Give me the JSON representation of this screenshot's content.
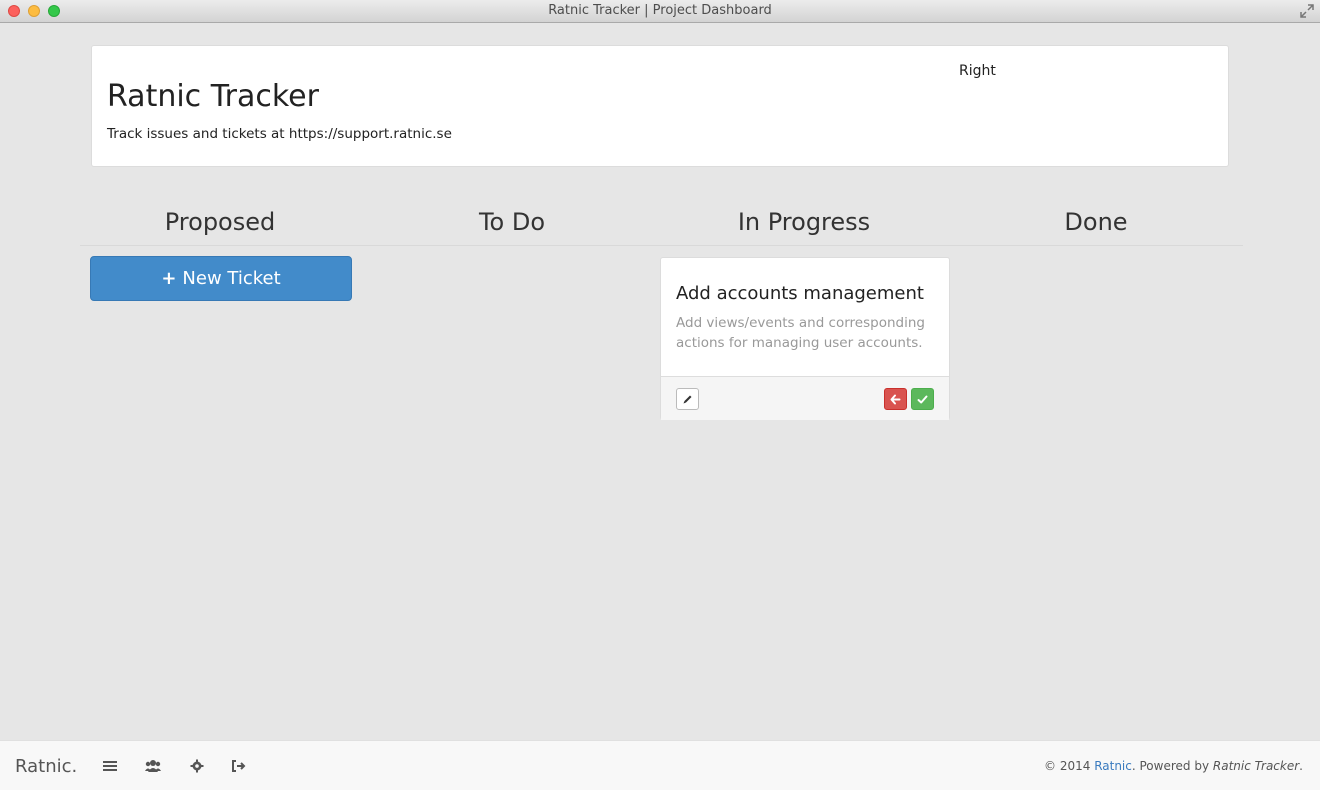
{
  "window": {
    "title": "Ratnic Tracker | Project Dashboard"
  },
  "header": {
    "title": "Ratnic Tracker",
    "subtitle": "Track issues and tickets at https://support.ratnic.se",
    "right_text": "Right"
  },
  "columns": [
    {
      "label": "Proposed"
    },
    {
      "label": "To Do"
    },
    {
      "label": "In Progress"
    },
    {
      "label": "Done"
    }
  ],
  "new_ticket": {
    "plus": "+",
    "label": "New Ticket"
  },
  "tickets": [
    {
      "column": "In Progress",
      "title": "Add accounts management",
      "description": "Add views/events and corresponding actions for managing user accounts."
    }
  ],
  "footer": {
    "brand": "Ratnic.",
    "icons": [
      "list-icon",
      "users-icon",
      "gear-icon",
      "sign-out-icon"
    ],
    "copyright_prefix": "© 2014",
    "copyright_link": "Ratnic",
    "copyright_mid": ". Powered by",
    "copyright_product": "Ratnic Tracker",
    "copyright_suffix": "."
  },
  "colors": {
    "primary": "#428bca",
    "danger": "#d9534f",
    "success": "#5cb85c",
    "background": "#e6e6e6"
  }
}
